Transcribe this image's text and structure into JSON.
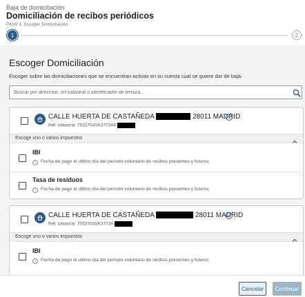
{
  "header": {
    "overline": "Baja de domiciliación",
    "title": "Domiciliación de recibos periódicos",
    "step_label": "PASO 1. Escoger Domiciliación",
    "step1": "1",
    "step2": "2"
  },
  "main": {
    "section_title": "Escoger Domiciliación",
    "section_desc": "Escoger sobre las domiciliaciones que se encuentran activas en su cuenta cual se quiere dar de baja.",
    "search": {
      "placeholder": "Buscar por dirección, ref catastral o identificador de terraza..."
    }
  },
  "cards": [
    {
      "address_pre": "CALLE HUERTA DE CASTAÑEDA",
      "address_post": "28011 MADRID",
      "ref_catastral": "Ref. catastral: 7032704VK3773A0",
      "group_label": "Escoge uno o varios impuestos",
      "taxes": [
        {
          "name": "IBI",
          "info": "Fecha de pago el ultimo día del periodo voluntario de recibos presentes y futuros"
        },
        {
          "name": "Tasa de residuos",
          "info": "Fecha de pago el ultimo día del periodo voluntario de recibos presentes y futuros"
        }
      ]
    },
    {
      "address_pre": "CALLE HUERTA DE CASTAÑEDA",
      "address_post": "28011 MADRID",
      "ref_catastral": "Ref. catastral: 7032704VK3773A",
      "group_label": "Escoge uno o varios impuestos",
      "taxes": [
        {
          "name": "IBI",
          "info": "Fecha de pago el ultimo día del periodo voluntario de recibos presentes y futuros"
        }
      ]
    }
  ],
  "footer": {
    "cancel_label": "Cancelar",
    "continue_label": "Continuar"
  },
  "colors": {
    "primary": "#2a5a87",
    "disabled_button": "#9bb4c8",
    "content_bg": "#f4f4f4"
  },
  "icons": [
    "search-icon",
    "home-icon",
    "info-icon",
    "chevron-up-icon"
  ]
}
